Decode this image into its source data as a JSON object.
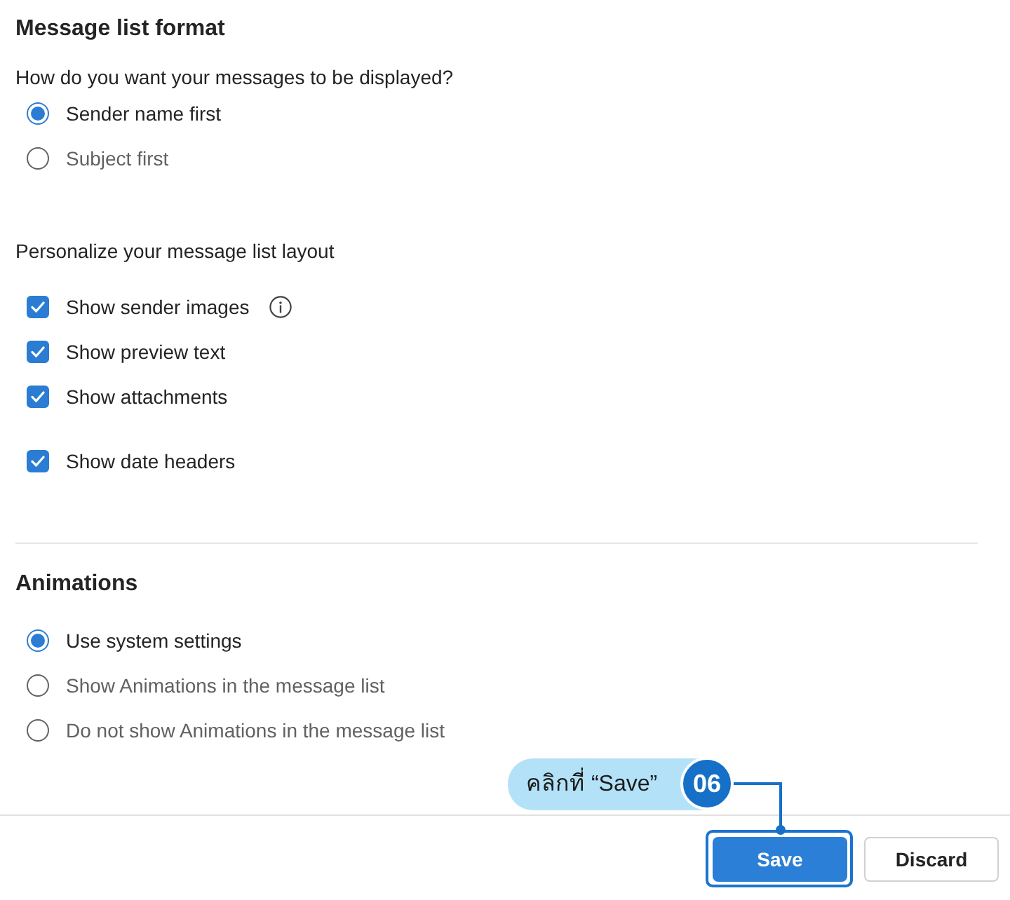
{
  "sections": [
    {
      "kind": "radio-group",
      "title": "Message list format",
      "question": "How do you want your messages to be displayed?",
      "options": [
        {
          "label": "Sender name first",
          "selected": true
        },
        {
          "label": "Subject first",
          "selected": false
        }
      ]
    },
    {
      "kind": "checkbox-group",
      "question": "Personalize your message list layout",
      "options": [
        {
          "label": "Show sender images",
          "checked": true,
          "info": true
        },
        {
          "label": "Show preview text",
          "checked": true
        },
        {
          "label": "Show attachments",
          "checked": true
        },
        {
          "label": "Show date headers",
          "checked": true
        }
      ]
    },
    {
      "kind": "radio-group",
      "title": "Animations",
      "options": [
        {
          "label": "Use system settings",
          "selected": true
        },
        {
          "label": "Show Animations in the message list",
          "selected": false
        },
        {
          "label": "Do not show Animations in the message list",
          "selected": false
        }
      ]
    }
  ],
  "footer": {
    "buttons": [
      {
        "label": "Save",
        "kind": "primary",
        "highlighted": true
      },
      {
        "label": "Discard",
        "kind": "secondary",
        "highlighted": false
      }
    ]
  },
  "annotation": {
    "label": "คลิกที่ “Save”",
    "step": "06"
  }
}
